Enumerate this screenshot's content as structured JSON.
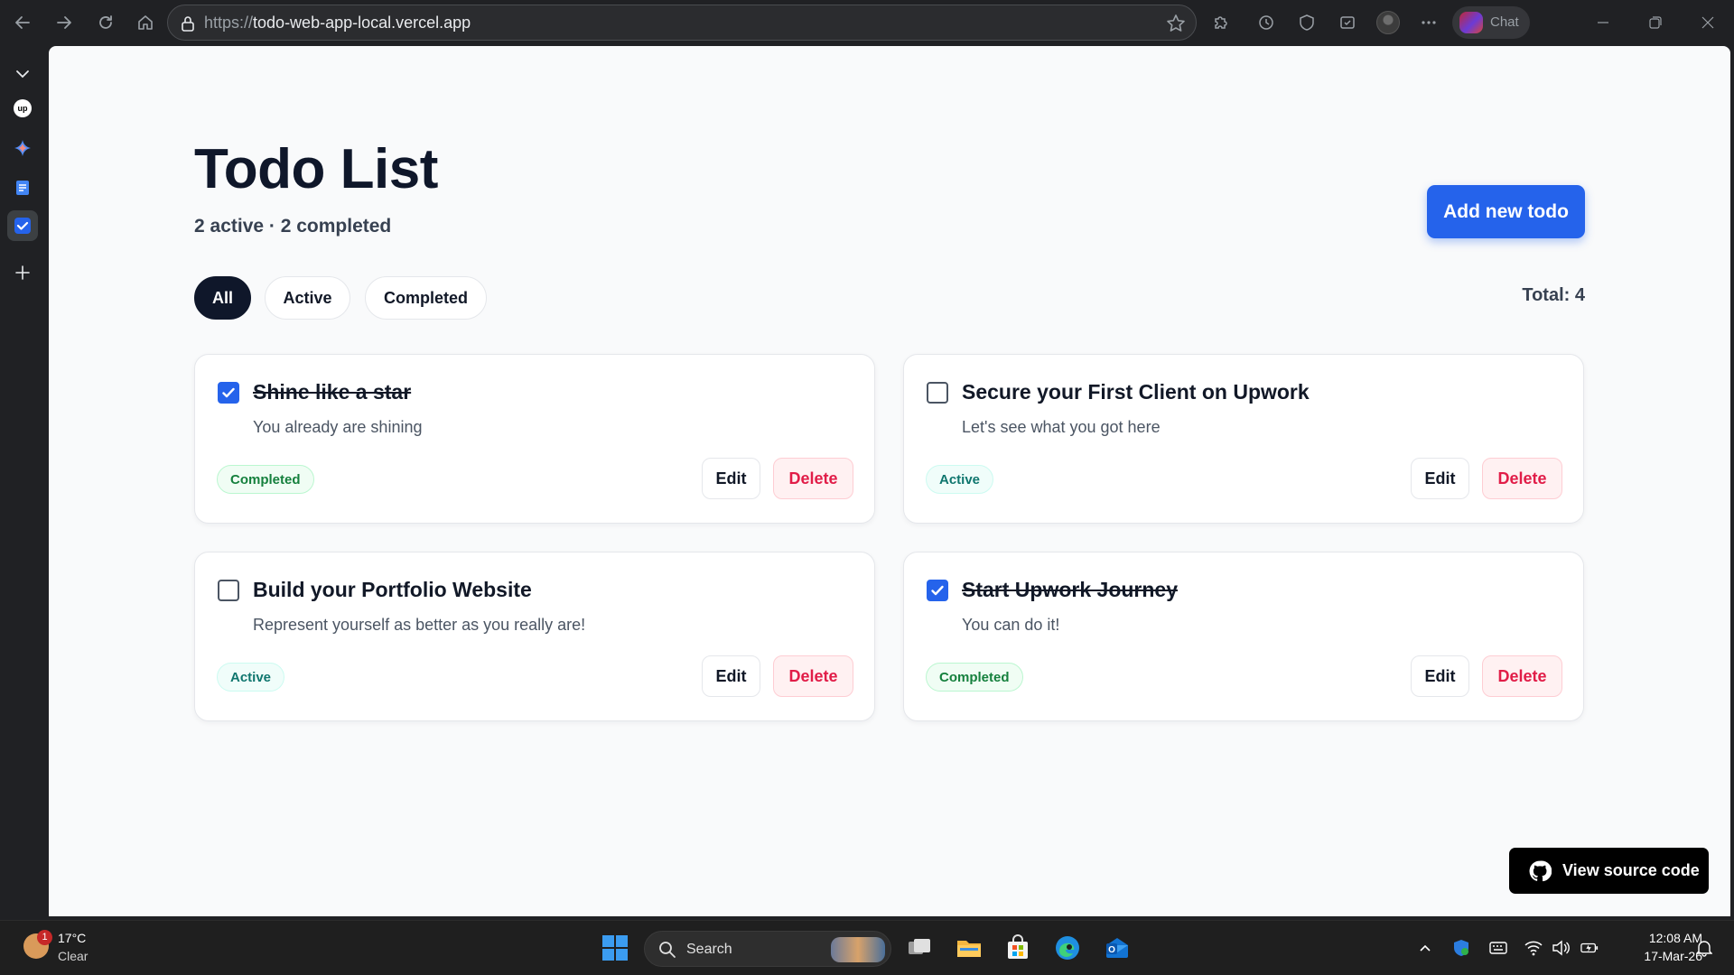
{
  "browser": {
    "url_protocol": "https://",
    "url_host": "todo-web-app-local.vercel.app",
    "chat_label": "Chat"
  },
  "page": {
    "title": "Todo List",
    "summary": "2 active · 2 completed",
    "add_button": "Add new todo",
    "filters": [
      {
        "label": "All",
        "selected": true
      },
      {
        "label": "Active",
        "selected": false
      },
      {
        "label": "Completed",
        "selected": false
      }
    ],
    "total": "Total: 4",
    "todos": [
      {
        "title": "Shine like a star",
        "description": "You already are shining",
        "completed": true,
        "status": "Completed",
        "edit_label": "Edit",
        "delete_label": "Delete"
      },
      {
        "title": "Secure your First Client on Upwork",
        "description": "Let's see what you got here",
        "completed": false,
        "status": "Active",
        "edit_label": "Edit",
        "delete_label": "Delete"
      },
      {
        "title": "Build your Portfolio Website",
        "description": "Represent yourself as better as you really are!",
        "completed": false,
        "status": "Active",
        "edit_label": "Edit",
        "delete_label": "Delete"
      },
      {
        "title": "Start Upwork Journey",
        "description": "You can do it!",
        "completed": true,
        "status": "Completed",
        "edit_label": "Edit",
        "delete_label": "Delete"
      }
    ],
    "source_button": "View source code"
  },
  "taskbar": {
    "weather_temp": "17°C",
    "weather_desc": "Clear",
    "weather_badge": "1",
    "search_label": "Search",
    "time": "12:08 AM",
    "date": "17-Mar-26"
  },
  "colors": {
    "accent": "#2563eb",
    "title_text": "#0f172a",
    "delete_text": "#e11d48",
    "completed_badge": "#15803d",
    "active_badge": "#0f766e"
  }
}
